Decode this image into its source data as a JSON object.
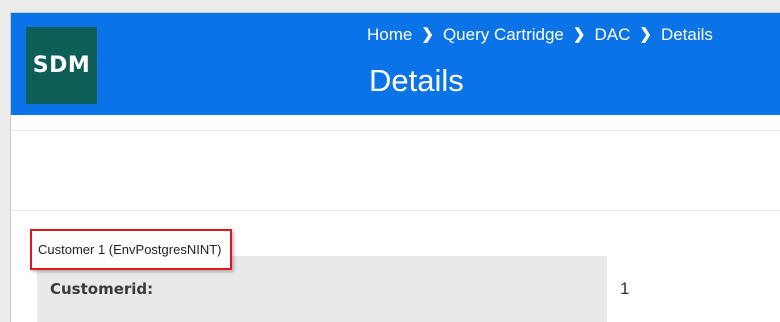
{
  "app": {
    "logo_text": "SDM"
  },
  "header": {
    "breadcrumb": [
      "Home",
      "Query Cartridge",
      "DAC",
      "Details"
    ],
    "title": "Details"
  },
  "record": {
    "label": "Customer 1 (EnvPostgresNINT)",
    "fields": [
      {
        "key": "Customerid:",
        "value": "1"
      }
    ]
  },
  "icons": {
    "breadcrumb_separator": "chevron-right-icon"
  },
  "colors": {
    "header_bg": "#0a73e8",
    "logo_bg": "#0c5e57",
    "highlight_border": "#e0161c",
    "field_key_bg": "#e9e9e9"
  }
}
